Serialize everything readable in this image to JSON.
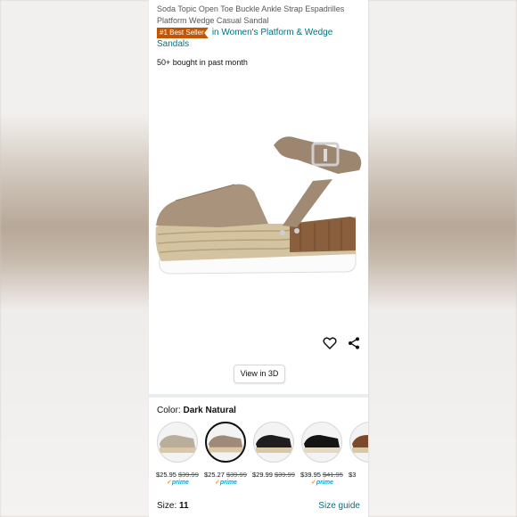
{
  "product": {
    "title": "Soda Topic Open Toe Buckle Ankle Strap Espadrilles Platform Wedge Casual Sandal",
    "best_seller_badge": "#1 Best Seller",
    "best_seller_category": "in Women's Platform & Wedge Sandals",
    "bought_text": "50+ bought in past month"
  },
  "actions": {
    "view_3d_label": "View in 3D",
    "heart_icon": "heart-icon",
    "share_icon": "share-icon"
  },
  "color": {
    "label": "Color:",
    "selected_name": "Dark Natural",
    "swatches": [
      {
        "price": "$25.95",
        "list_price": "$39.99",
        "prime": "prime",
        "shoe_color": "#b9ad9c"
      },
      {
        "price": "$25.27",
        "list_price": "$39.99",
        "prime": "prime",
        "shoe_color": "#9e8a76",
        "selected": true
      },
      {
        "price": "$29.99",
        "list_price": "$39.99",
        "prime": "",
        "shoe_color": "#1e1e1e"
      },
      {
        "price": "$39.95",
        "list_price": "$41.95",
        "prime": "prime",
        "shoe_color": "#141414"
      },
      {
        "price": "$3",
        "list_price": "",
        "prime": "",
        "shoe_color": "#7a4a2a"
      }
    ]
  },
  "size": {
    "label": "Size:",
    "value": "11",
    "guide_label": "Size guide"
  },
  "colors": {
    "link": "#007185",
    "badge": "#c45500",
    "prime": "#00a8e1"
  }
}
